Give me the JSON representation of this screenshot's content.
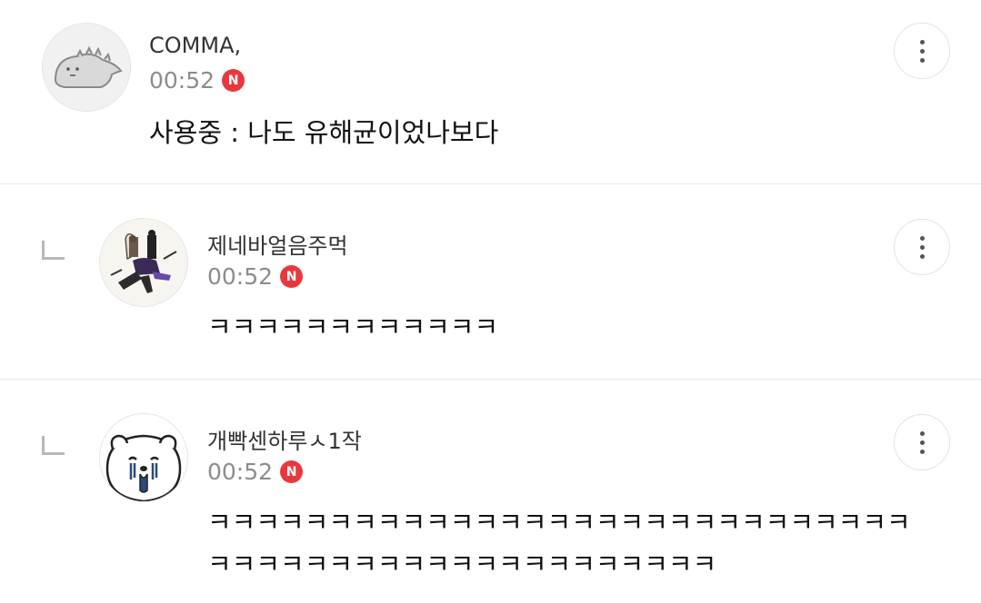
{
  "comments": [
    {
      "nickname": "COMMA,",
      "time": "00:52",
      "badge": "N",
      "text": "사용중 : 나도 유해균이었나보다",
      "is_reply": false,
      "avatar_icon": "dinosaur-avatar-icon"
    },
    {
      "nickname": "제네바얼음주먹",
      "time": "00:52",
      "badge": "N",
      "text": "ㅋㅋㅋㅋㅋㅋㅋㅋㅋㅋㅋㅋ",
      "is_reply": true,
      "avatar_icon": "group-illustration-avatar-icon"
    },
    {
      "nickname": "개빡센하루ㅅ1작",
      "time": "00:52",
      "badge": "N",
      "text_lines": [
        "ㅋㅋㅋㅋㅋㅋㅋㅋㅋㅋㅋㅋㅋㅋㅋㅋㅋㅋㅋㅋㅋㅋㅋㅋㅋㅋㅋㅋㅋ",
        "ㅋㅋㅋㅋㅋㅋㅋㅋㅋㅋㅋㅋㅋㅋㅋㅋㅋㅋㅋㅋㅋ"
      ],
      "is_reply": true,
      "avatar_icon": "crying-bear-avatar-icon"
    }
  ],
  "colors": {
    "badge_red": "#e8383d",
    "time_gray": "#8c8c8c",
    "divider": "#e6e6e6"
  }
}
